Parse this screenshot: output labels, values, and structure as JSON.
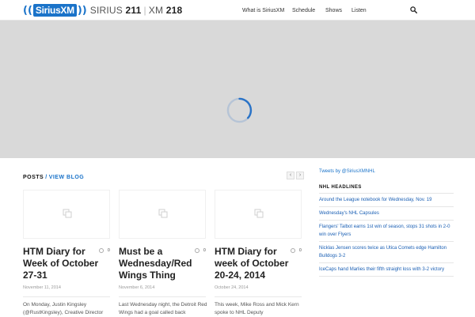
{
  "header": {
    "logo_brand": "SiriusXM",
    "logo_sirius_label": "SIRIUS",
    "logo_sirius_channel": "211",
    "logo_xm_label": "XM",
    "logo_xm_channel": "218",
    "nav": [
      "What is SiriusXM",
      "Schedule",
      "Shows",
      "Listen"
    ]
  },
  "posts": {
    "title": "POSTS",
    "divider": "/",
    "view_blog": "VIEW BLOG",
    "prev_arrow": "‹",
    "next_arrow": "›",
    "items": [
      {
        "title": "HTM Diary for Week of October 27-31",
        "date": "November 11, 2014",
        "comments": "0",
        "excerpt": "On Monday, Justin Kingsley (@RustKingsley), Creative Director"
      },
      {
        "title": "Must be a Wednesday/Red Wings Thing",
        "date": "November 6, 2014",
        "comments": "0",
        "excerpt": "Last Wednesday night, the Detroit Red Wings had a goal called back"
      },
      {
        "title": "HTM Diary for week of October 20-24, 2014",
        "date": "October 24, 2014",
        "comments": "0",
        "excerpt": "This week, Mike Ross and Mick Kern spoke to NHL Deputy"
      }
    ]
  },
  "sidebar": {
    "tweets_link": "Tweets by @SiriusXMNHL",
    "headlines_title": "NHL HEADLINES",
    "headlines": [
      "Around the League notebook for Wednesday, Nov. 19",
      "Wednesday's NHL Capsules",
      "Flangers' Talbot earns 1st win of season, stops 31 shots in 2-0 win over Flyers",
      "Nicklas Jensen scores twice as Utica Comets edge Hamilton Bulldogs 3-2",
      "IceCaps hand Marlies their fifth straight loss with 3-2 victory"
    ]
  },
  "colors": {
    "accent": "#1a73c9",
    "hero_bg": "#d9d9d9",
    "link": "#1a5fb4"
  },
  "icons": {
    "search": "search-icon",
    "spinner": "loading-spinner-icon",
    "image_placeholder": "image-placeholder-icon",
    "comment": "comment-bubble-icon"
  }
}
